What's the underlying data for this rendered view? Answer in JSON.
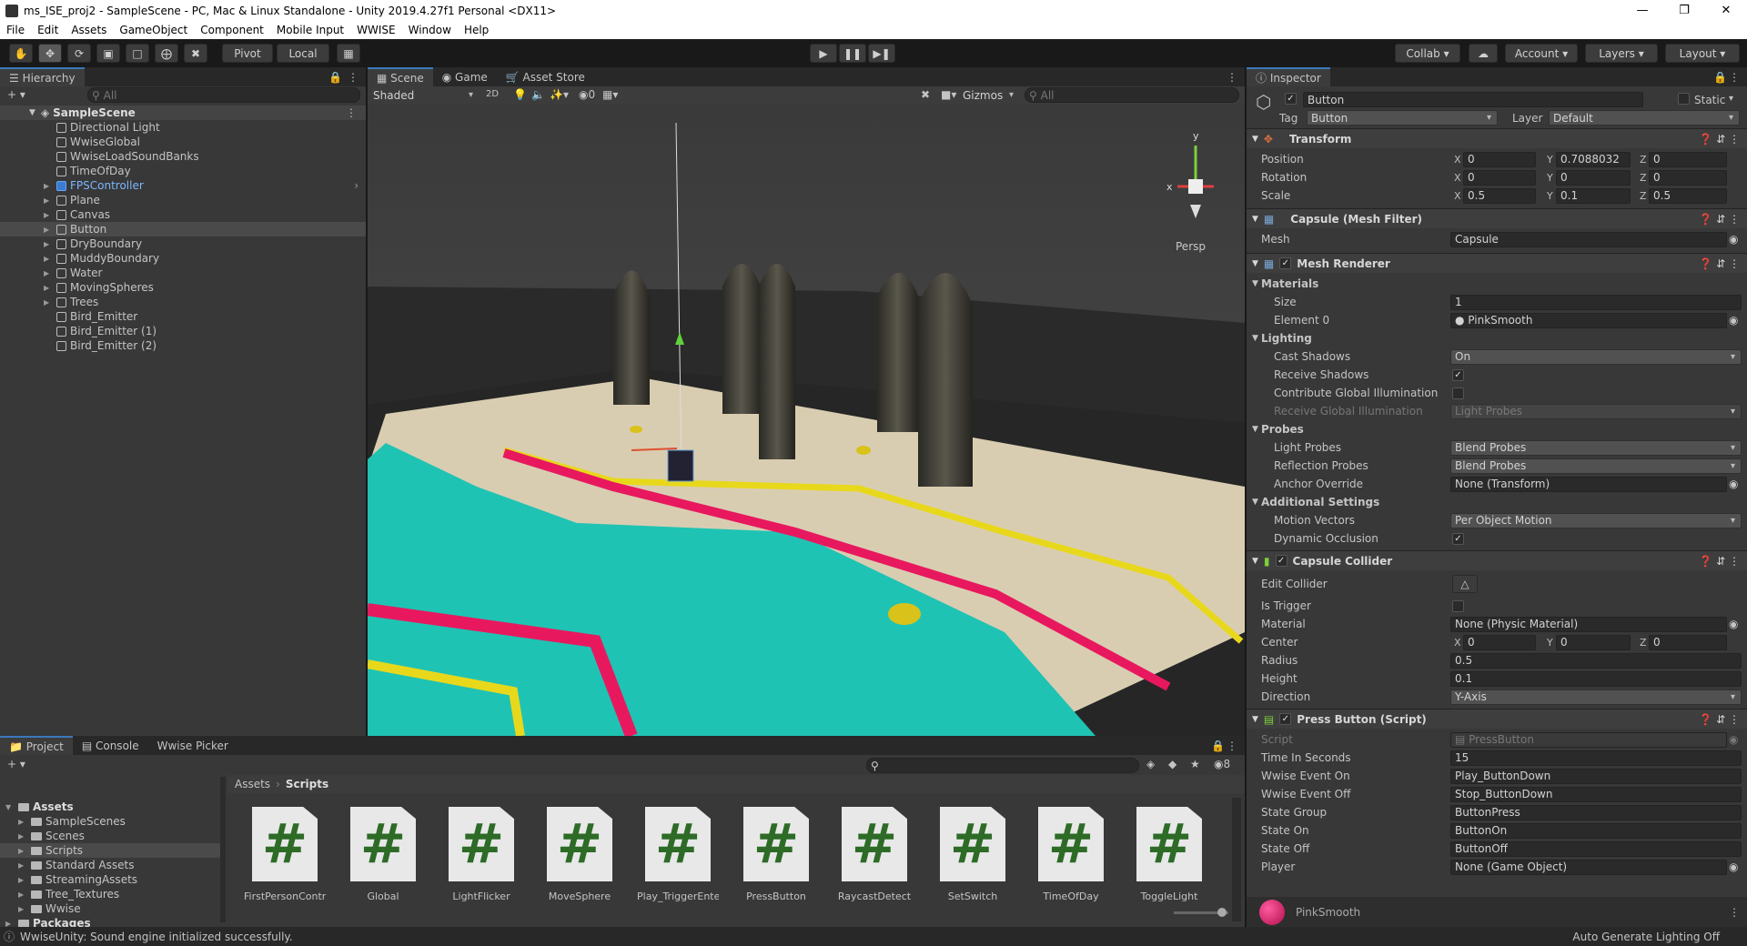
{
  "window": {
    "title": "ms_ISE_proj2 - SampleScene - PC, Mac & Linux Standalone - Unity 2019.4.27f1 Personal <DX11>"
  },
  "menu": [
    "File",
    "Edit",
    "Assets",
    "GameObject",
    "Component",
    "Mobile Input",
    "WWISE",
    "Window",
    "Help"
  ],
  "toolbar": {
    "pivot": "Pivot",
    "local": "Local",
    "collab": "Collab",
    "account": "Account",
    "layers": "Layers",
    "layout": "Layout"
  },
  "hierarchy": {
    "tab": "Hierarchy",
    "search_placeholder": "All",
    "scene": "SampleScene",
    "items": [
      {
        "label": "Directional Light",
        "expandable": false,
        "blue": false
      },
      {
        "label": "WwiseGlobal",
        "expandable": false,
        "blue": false
      },
      {
        "label": "WwiseLoadSoundBanks",
        "expandable": false,
        "blue": false
      },
      {
        "label": "TimeOfDay",
        "expandable": false,
        "blue": false
      },
      {
        "label": "FPSController",
        "expandable": true,
        "blue": true
      },
      {
        "label": "Plane",
        "expandable": true,
        "blue": false
      },
      {
        "label": "Canvas",
        "expandable": true,
        "blue": false
      },
      {
        "label": "Button",
        "expandable": true,
        "blue": false,
        "selected": true
      },
      {
        "label": "DryBoundary",
        "expandable": true,
        "blue": false
      },
      {
        "label": "MuddyBoundary",
        "expandable": true,
        "blue": false
      },
      {
        "label": "Water",
        "expandable": true,
        "blue": false
      },
      {
        "label": "MovingSpheres",
        "expandable": true,
        "blue": false
      },
      {
        "label": "Trees",
        "expandable": true,
        "blue": false
      },
      {
        "label": "Bird_Emitter",
        "expandable": false,
        "blue": false
      },
      {
        "label": "Bird_Emitter (1)",
        "expandable": false,
        "blue": false
      },
      {
        "label": "Bird_Emitter (2)",
        "expandable": false,
        "blue": false
      }
    ]
  },
  "scene": {
    "tabs": [
      "Scene",
      "Game",
      "Asset Store"
    ],
    "shading": "Shaded",
    "mode_2d": "2D",
    "hidden_count": "0",
    "gizmos": "Gizmos",
    "search_placeholder": "All",
    "persp": "Persp",
    "axis_x": "x",
    "axis_y": "y"
  },
  "inspector": {
    "tab": "Inspector",
    "name": "Button",
    "static": "Static",
    "tag_label": "Tag",
    "tag": "Button",
    "layer_label": "Layer",
    "layer": "Default",
    "transform": {
      "title": "Transform",
      "position_label": "Position",
      "position": [
        "0",
        "0.7088032",
        "0"
      ],
      "rotation_label": "Rotation",
      "rotation": [
        "0",
        "0",
        "0"
      ],
      "scale_label": "Scale",
      "scale": [
        "0.5",
        "0.1",
        "0.5"
      ]
    },
    "mesh_filter": {
      "title": "Capsule (Mesh Filter)",
      "mesh_label": "Mesh",
      "mesh": "Capsule"
    },
    "mesh_renderer": {
      "title": "Mesh Renderer",
      "materials": "Materials",
      "size_label": "Size",
      "size": "1",
      "element0_label": "Element 0",
      "element0": "PinkSmooth",
      "lighting": "Lighting",
      "cast_shadows_label": "Cast Shadows",
      "cast_shadows": "On",
      "receive_shadows_label": "Receive Shadows",
      "contribute_gi_label": "Contribute Global Illumination",
      "receive_gi_label": "Receive Global Illumination",
      "receive_gi": "Light Probes",
      "probes": "Probes",
      "light_probes_label": "Light Probes",
      "light_probes": "Blend Probes",
      "reflection_probes_label": "Reflection Probes",
      "reflection_probes": "Blend Probes",
      "anchor_override_label": "Anchor Override",
      "anchor_override": "None (Transform)",
      "additional": "Additional Settings",
      "motion_vectors_label": "Motion Vectors",
      "motion_vectors": "Per Object Motion",
      "dynamic_occlusion_label": "Dynamic Occlusion"
    },
    "capsule_collider": {
      "title": "Capsule Collider",
      "edit_label": "Edit Collider",
      "is_trigger_label": "Is Trigger",
      "material_label": "Material",
      "material": "None (Physic Material)",
      "center_label": "Center",
      "center": [
        "0",
        "0",
        "0"
      ],
      "radius_label": "Radius",
      "radius": "0.5",
      "height_label": "Height",
      "height": "0.1",
      "direction_label": "Direction",
      "direction": "Y-Axis"
    },
    "press_button": {
      "title": "Press Button (Script)",
      "script_label": "Script",
      "script": "PressButton",
      "time_label": "Time In Seconds",
      "time": "15",
      "on_label": "Wwise Event On",
      "on": "Play_ButtonDown",
      "off_label": "Wwise Event Off",
      "off": "Stop_ButtonDown",
      "group_label": "State Group",
      "group": "ButtonPress",
      "state_on_label": "State On",
      "state_on": "ButtonOn",
      "state_off_label": "State Off",
      "state_off": "ButtonOff",
      "player_label": "Player",
      "player": "None (Game Object)"
    },
    "material_preview": "PinkSmooth"
  },
  "project": {
    "tabs": [
      "Project",
      "Console",
      "Wwise Picker"
    ],
    "hidden_count": "8",
    "breadcrumb": [
      "Assets",
      "Scripts"
    ],
    "tree": [
      {
        "label": "Assets",
        "depth": 0,
        "bold": true,
        "open": true
      },
      {
        "label": "SampleScenes",
        "depth": 1,
        "bold": false
      },
      {
        "label": "Scenes",
        "depth": 1,
        "bold": false
      },
      {
        "label": "Scripts",
        "depth": 1,
        "bold": false,
        "selected": true
      },
      {
        "label": "Standard Assets",
        "depth": 1,
        "bold": false
      },
      {
        "label": "StreamingAssets",
        "depth": 1,
        "bold": false
      },
      {
        "label": "Tree_Textures",
        "depth": 1,
        "bold": false
      },
      {
        "label": "Wwise",
        "depth": 1,
        "bold": false
      },
      {
        "label": "Packages",
        "depth": 0,
        "bold": true
      }
    ],
    "assets": [
      "FirstPersonContro...",
      "Global",
      "LightFlicker",
      "MoveSphere",
      "Play_TriggerEnter",
      "PressButton",
      "RaycastDetect",
      "SetSwitch",
      "TimeOfDay",
      "ToggleLight"
    ],
    "asset_glyph": "#"
  },
  "status": {
    "message": "WwiseUnity: Sound engine initialized successfully.",
    "lighting": "Auto Generate Lighting Off"
  },
  "colors": {
    "accent": "#3a79bb",
    "selection": "#4a4a4a",
    "script_green": "#2d6b27",
    "water": "#1fc3b3",
    "pink": "#e8185f",
    "yellow": "#e8d81c"
  }
}
